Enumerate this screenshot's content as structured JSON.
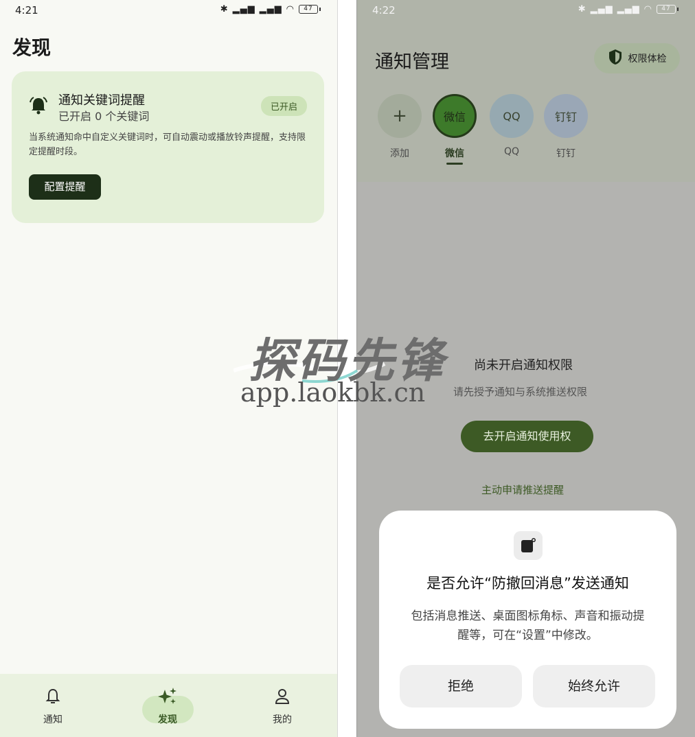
{
  "left": {
    "status": {
      "time": "4:21",
      "battery": "47"
    },
    "title": "发现",
    "card": {
      "title": "通知关键词提醒",
      "subtitle": "已开启 0 个关键词",
      "badge": "已开启",
      "description": "当系统通知命中自定义关键词时，可自动震动或播放铃声提醒，支持限定提醒时段。",
      "button": "配置提醒"
    },
    "tabs": [
      {
        "label": "通知",
        "icon": "bell-icon"
      },
      {
        "label": "发现",
        "icon": "sparkle-icon"
      },
      {
        "label": "我的",
        "icon": "person-icon"
      }
    ]
  },
  "right": {
    "status": {
      "time": "4:22",
      "battery": "47"
    },
    "title": "通知管理",
    "perm_button": "权限体检",
    "apps": [
      {
        "circle": "+",
        "label": "添加"
      },
      {
        "circle": "微信",
        "label": "微信"
      },
      {
        "circle": "QQ",
        "label": "QQ"
      },
      {
        "circle": "钉钉",
        "label": "钉钉"
      }
    ],
    "empty_title": "尚未开启通知权限",
    "empty_sub": "请先授予通知与系统推送权限",
    "open_button": "去开启通知使用权",
    "push_link": "主动申请推送提醒",
    "dialog": {
      "title": "是否允许“防撤回消息”发送通知",
      "body": "包括消息推送、桌面图标角标、声音和振动提醒等，可在“设置”中修改。",
      "deny": "拒绝",
      "allow": "始终允许"
    }
  },
  "watermark": {
    "brand": "探码先锋",
    "url": "app.laokbk.cn"
  },
  "colors": {
    "accent_dark": "#1d2f18",
    "accent_green": "#3d5a25",
    "card_bg": "#e4f0d8",
    "wechat_green": "#3d7a2a"
  }
}
